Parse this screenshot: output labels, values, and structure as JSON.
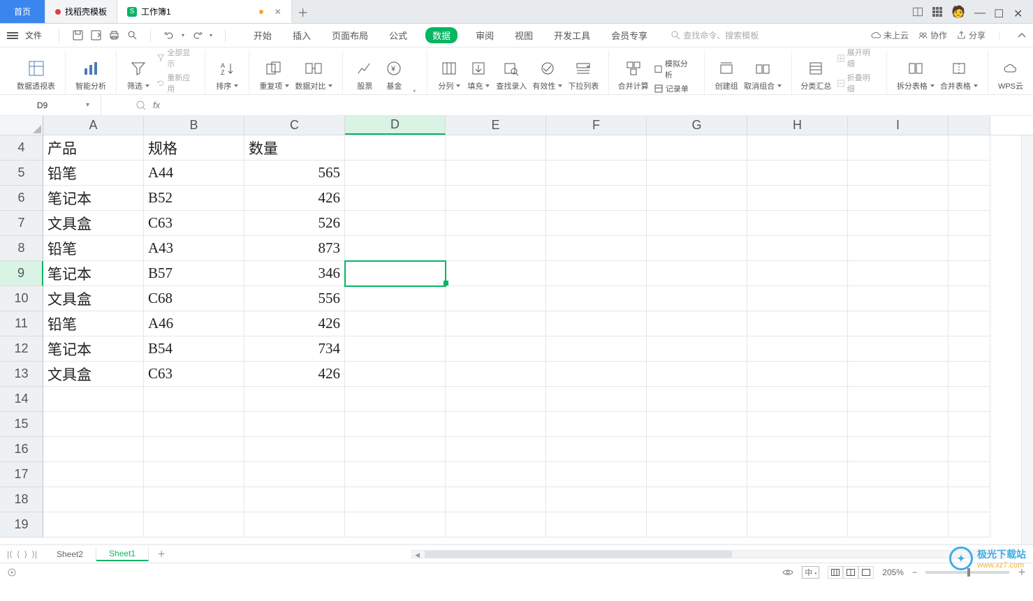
{
  "tabs": {
    "home": "首页",
    "template": "找稻壳模板",
    "workbook": "工作簿1"
  },
  "menubar": {
    "file": "文件",
    "items": [
      "开始",
      "插入",
      "页面布局",
      "公式",
      "数据",
      "审阅",
      "视图",
      "开发工具",
      "会员专享"
    ],
    "active_index": 4,
    "search_placeholder": "查找命令、搜索模板",
    "cloud": "未上云",
    "coop": "协作",
    "share": "分享"
  },
  "ribbon": {
    "pivottable": "数据透视表",
    "smart_analyze": "智能分析",
    "filter": "筛选",
    "show_all": "全部显示",
    "reapply": "重新应用",
    "sort": "排序",
    "dedup": "重复项",
    "compare": "数据对比",
    "stock": "股票",
    "fund": "基金",
    "text_to_cols": "分列",
    "fill": "填充",
    "find_entry": "查找录入",
    "validity": "有效性",
    "dropdown_list": "下拉列表",
    "consolidate": "合并计算",
    "whatif": "模拟分析",
    "record_form": "记录单",
    "group_create": "创建组",
    "group_ungroup": "取消组合",
    "subtotal": "分类汇总",
    "expand_detail": "展开明细",
    "collapse_detail": "折叠明细",
    "split_table": "拆分表格",
    "merge_table": "合并表格",
    "wps_cloud": "WPS云"
  },
  "namebox": "D9",
  "columns": [
    "A",
    "B",
    "C",
    "D",
    "E",
    "F",
    "G",
    "H",
    "I"
  ],
  "sel_col_index": 3,
  "sel_row_number": 9,
  "row_start": 4,
  "row_count": 16,
  "data_rows": [
    {
      "r": 4,
      "A": "产品",
      "B": "规格",
      "C": "数量",
      "Ctype": "text"
    },
    {
      "r": 5,
      "A": "铅笔",
      "B": "A44",
      "C": "565"
    },
    {
      "r": 6,
      "A": "笔记本",
      "B": "B52",
      "C": "426"
    },
    {
      "r": 7,
      "A": "文具盒",
      "B": "C63",
      "C": "526"
    },
    {
      "r": 8,
      "A": "铅笔",
      "B": "A43",
      "C": "873"
    },
    {
      "r": 9,
      "A": "笔记本",
      "B": "B57",
      "C": "346"
    },
    {
      "r": 10,
      "A": "文具盒",
      "B": "C68",
      "C": "556"
    },
    {
      "r": 11,
      "A": "铅笔",
      "B": "A46",
      "C": "426"
    },
    {
      "r": 12,
      "A": "笔记本",
      "B": "B54",
      "C": "734"
    },
    {
      "r": 13,
      "A": "文具盒",
      "B": "C63",
      "C": "426"
    }
  ],
  "sheets": {
    "inactive": "Sheet2",
    "active": "Sheet1"
  },
  "status": {
    "zoom": "205%"
  },
  "watermark": {
    "t1": "极光下载站",
    "t2": "www.xz7.com"
  },
  "colors": {
    "accent": "#07b562",
    "tab_home": "#3a86ee"
  }
}
